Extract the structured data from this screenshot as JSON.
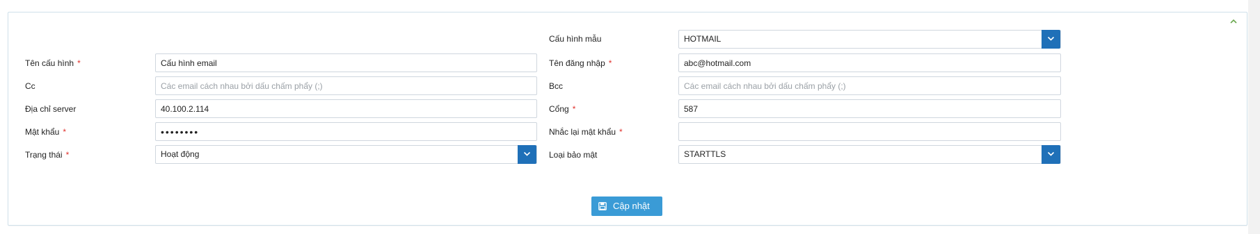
{
  "form": {
    "left": {
      "ten_cau_hinh": {
        "label": "Tên cấu hình",
        "required": "*",
        "value": "Cấu hình email"
      },
      "cc": {
        "label": "Cc",
        "placeholder": "Các email cách nhau bởi dấu chấm phẩy (;)"
      },
      "dia_chi_server": {
        "label": "Địa chỉ server",
        "value": "40.100.2.114"
      },
      "mat_khau": {
        "label": "Mật khẩu",
        "required": "*",
        "value": "••••••••"
      },
      "trang_thai": {
        "label": "Trạng thái",
        "required": "*",
        "value": "Hoạt động"
      }
    },
    "right": {
      "cau_hinh_mau": {
        "label": "Cấu hình mẫu",
        "value": "HOTMAIL"
      },
      "ten_dang_nhap": {
        "label": "Tên đăng nhập",
        "required": "*",
        "value": "abc@hotmail.com"
      },
      "bcc": {
        "label": "Bcc",
        "placeholder": "Các email cách nhau bởi dấu chấm phẩy (;)"
      },
      "cong": {
        "label": "Cổng",
        "required": "*",
        "value": "587"
      },
      "nhac_lai_mat_khau": {
        "label": "Nhắc lại mật khẩu",
        "required": "*",
        "value": ""
      },
      "loai_bao_mat": {
        "label": "Loại bảo mật",
        "value": "STARTTLS"
      }
    },
    "submit_label": "Cập nhật"
  },
  "icons": {
    "collapse": "chevron-up-icon",
    "dropdown": "chevron-down-icon",
    "save": "floppy-disk-icon"
  },
  "colors": {
    "accent": "#1f70b8",
    "button": "#3a9bd6",
    "required": "#e0322d",
    "collapse": "#6aa84f"
  }
}
